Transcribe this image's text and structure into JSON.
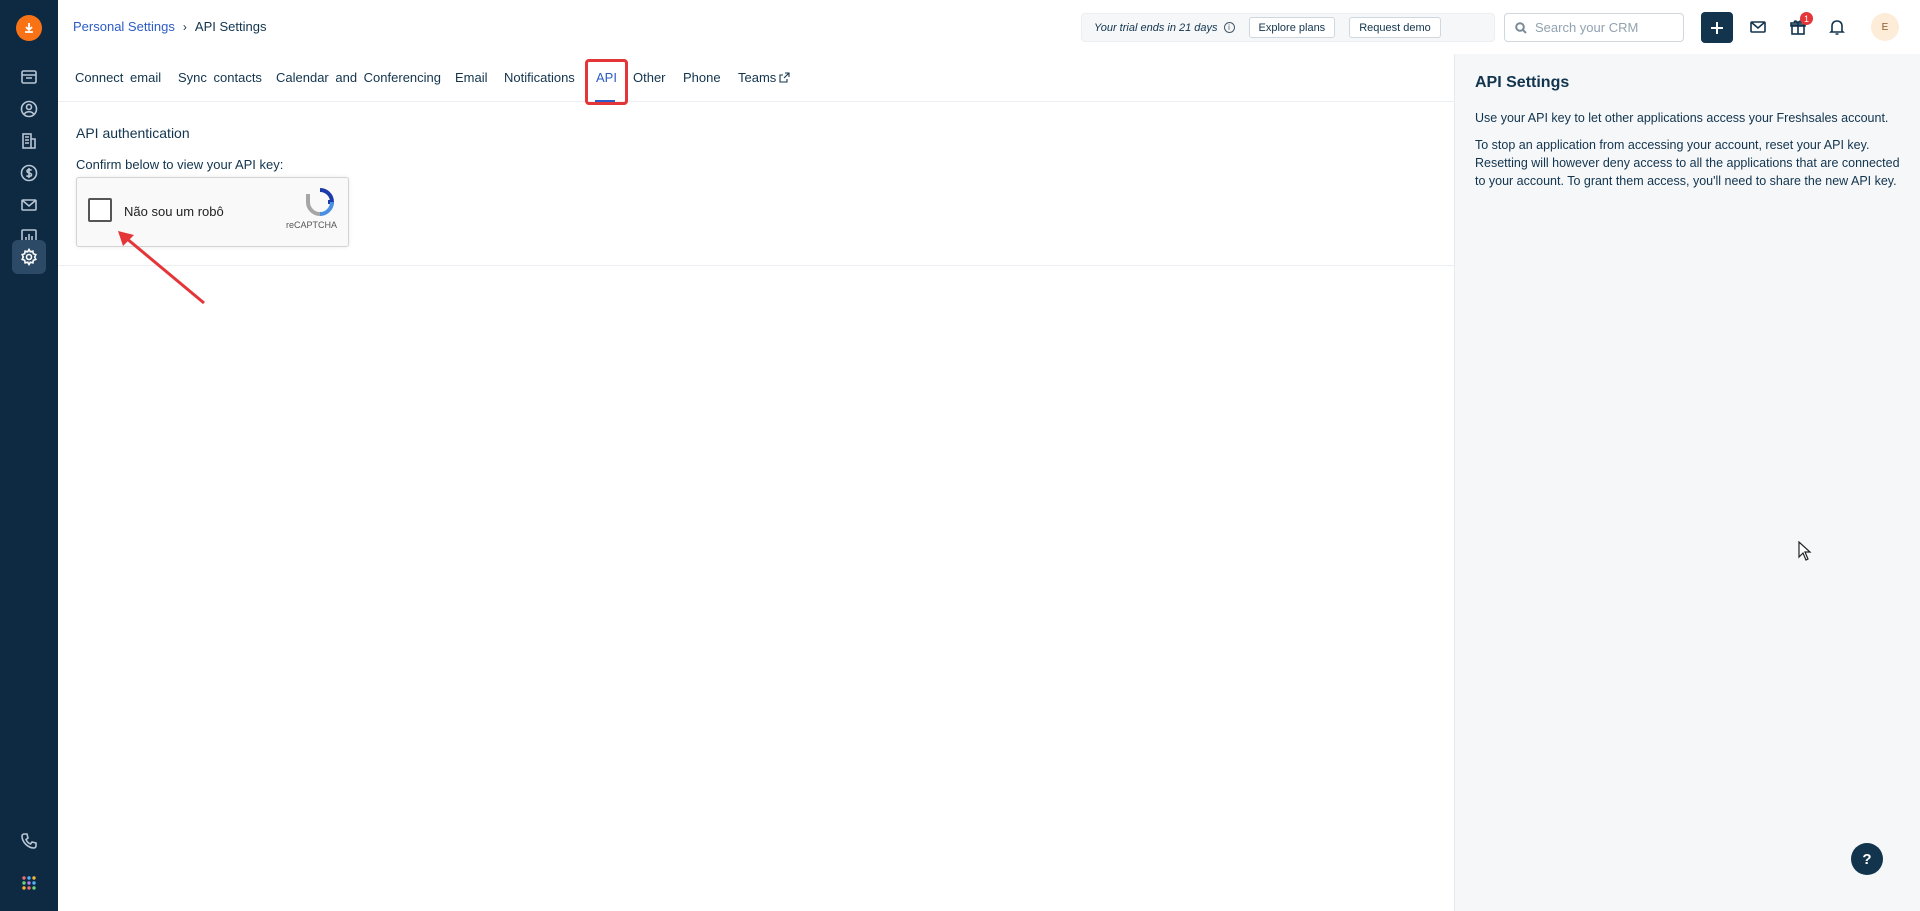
{
  "breadcrumb": {
    "parent": "Personal Settings",
    "current": "API Settings"
  },
  "header": {
    "trial_text": "Your trial ends in 21 days",
    "explore_label": "Explore plans",
    "demo_label": "Request demo",
    "search_placeholder": "Search your CRM",
    "gift_badge": "1",
    "avatar_initial": "E"
  },
  "tabs": [
    {
      "label": "Connect email"
    },
    {
      "label": "Sync contacts"
    },
    {
      "label": "Calendar and Conferencing"
    },
    {
      "label": "Email"
    },
    {
      "label": "Notifications"
    },
    {
      "label": "API"
    },
    {
      "label": "Other"
    },
    {
      "label": "Phone"
    },
    {
      "label": "Teams"
    }
  ],
  "main": {
    "section_title": "API authentication",
    "confirm_text": "Confirm below to view your API key:",
    "captcha_label": "Não sou um robô",
    "captcha_brand": "reCAPTCHA"
  },
  "panel": {
    "title": "API Settings",
    "p1": "Use your API key to let other applications access your Freshsales account.",
    "p2": "To stop an application from accessing your account, reset your API key. Resetting will however deny access to all the applications that are connected to your account. To grant them access, you'll need to share the new API key."
  },
  "help_label": "?",
  "colors": {
    "rail": "#0d2a42",
    "accent": "#2c5cc5",
    "highlight": "#e43538",
    "logo": "#f97316"
  }
}
